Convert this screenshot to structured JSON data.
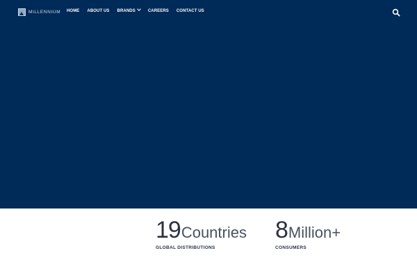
{
  "brand": {
    "logo_text": "MILLENNIUM",
    "logo_icon": "mountain-logo-icon",
    "hero_color": "#002a57"
  },
  "nav": {
    "items": [
      {
        "label": "HOME"
      },
      {
        "label": "ABOUT US"
      },
      {
        "label": "BRANDS",
        "has_dropdown": true
      },
      {
        "label": "CAREERS"
      },
      {
        "label": "CONTACT US"
      }
    ],
    "search_icon": "search-icon"
  },
  "stats": [
    {
      "number": "19",
      "unit": "Countries",
      "caption": "GLOBAL DISTRIBUTIONS"
    },
    {
      "number": "8",
      "unit": "Million+",
      "caption": "CONSUMERS"
    }
  ]
}
